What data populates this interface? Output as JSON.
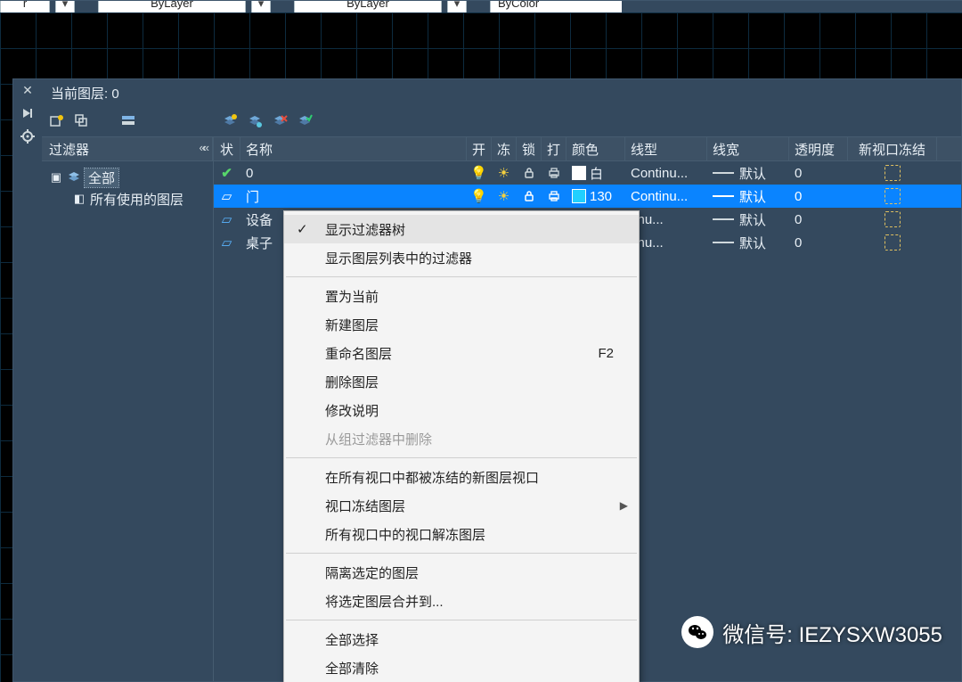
{
  "topStrip": {
    "seg0": "r",
    "seg1": "ByLayer",
    "seg2": "ByLayer",
    "seg3": "ByColor"
  },
  "palette": {
    "currentLayerLabel": "当前图层: 0",
    "filtersTitle": "过滤器",
    "tree": {
      "root": "全部",
      "child1": "所有使用的图层"
    },
    "columns": {
      "status": "状",
      "name": "名称",
      "on": "开",
      "freeze": "冻",
      "lock": "锁",
      "plot": "打",
      "color": "颜色",
      "linetype": "线型",
      "lineweight": "线宽",
      "transparency": "透明度",
      "vpFreeze": "新视口冻结"
    },
    "rows": [
      {
        "name": "0",
        "colorLabel": "白",
        "swatch": "#ffffff",
        "linetype": "Continu...",
        "lineweight": "默认",
        "transparency": "0"
      },
      {
        "name": "门",
        "colorLabel": "130",
        "swatch": "#21d0ff",
        "linetype": "Continu...",
        "lineweight": "默认",
        "transparency": "0"
      },
      {
        "name": "设备",
        "colorLabel": "",
        "swatch": "",
        "linetype": "tinu...",
        "lineweight": "默认",
        "transparency": "0"
      },
      {
        "name": "桌子",
        "colorLabel": "",
        "swatch": "",
        "linetype": "tinu...",
        "lineweight": "默认",
        "transparency": "0"
      }
    ]
  },
  "contextMenu": {
    "items": [
      {
        "label": "显示过滤器树",
        "checked": true
      },
      {
        "label": "显示图层列表中的过滤器"
      },
      {
        "sep": true
      },
      {
        "label": "置为当前"
      },
      {
        "label": "新建图层"
      },
      {
        "label": "重命名图层",
        "accel": "F2"
      },
      {
        "label": "删除图层"
      },
      {
        "label": "修改说明"
      },
      {
        "label": "从组过滤器中删除",
        "disabled": true
      },
      {
        "sep": true
      },
      {
        "label": "在所有视口中都被冻结的新图层视口"
      },
      {
        "label": "视口冻结图层",
        "submenu": true
      },
      {
        "label": "所有视口中的视口解冻图层"
      },
      {
        "sep": true
      },
      {
        "label": "隔离选定的图层"
      },
      {
        "label": "将选定图层合并到..."
      },
      {
        "sep": true
      },
      {
        "label": "全部选择"
      },
      {
        "label": "全部清除"
      }
    ]
  },
  "watermark": {
    "text": "微信号: IEZYSXW3055"
  }
}
